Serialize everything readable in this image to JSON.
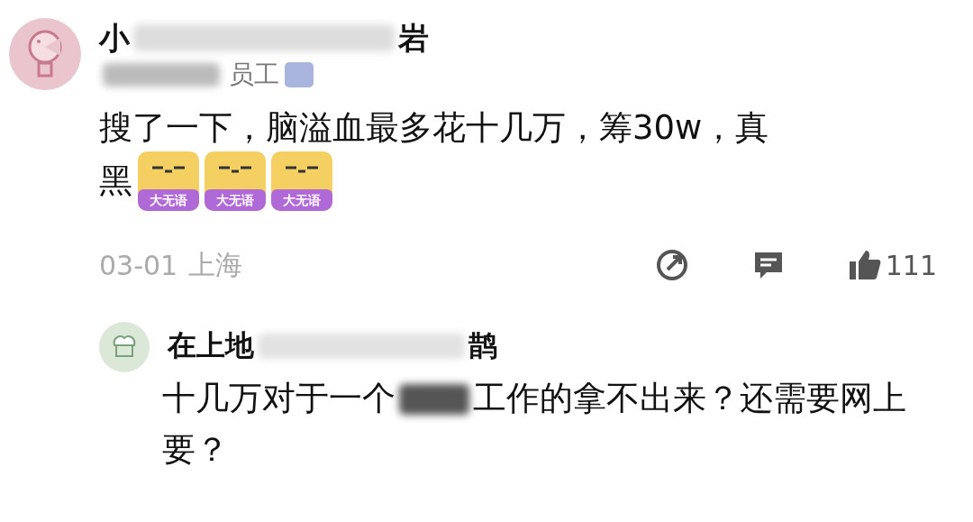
{
  "comment": {
    "author": {
      "name_start": "小",
      "name_end": "岩",
      "title": "员工",
      "verified": true
    },
    "body_lines": [
      "搜了一下，脑溢血最多花十几万，筹30w，真",
      "黑"
    ],
    "stickers": [
      {
        "label": "大无语"
      },
      {
        "label": "大无语"
      },
      {
        "label": "大无语"
      }
    ],
    "date": "03-01",
    "location": "上海",
    "likes": "111"
  },
  "reply": {
    "author": {
      "name_start": "在上地",
      "name_end": "鹊"
    },
    "text_start": "十几万对于一个",
    "text_end": "工作的拿不出来？还需要网上要？"
  }
}
